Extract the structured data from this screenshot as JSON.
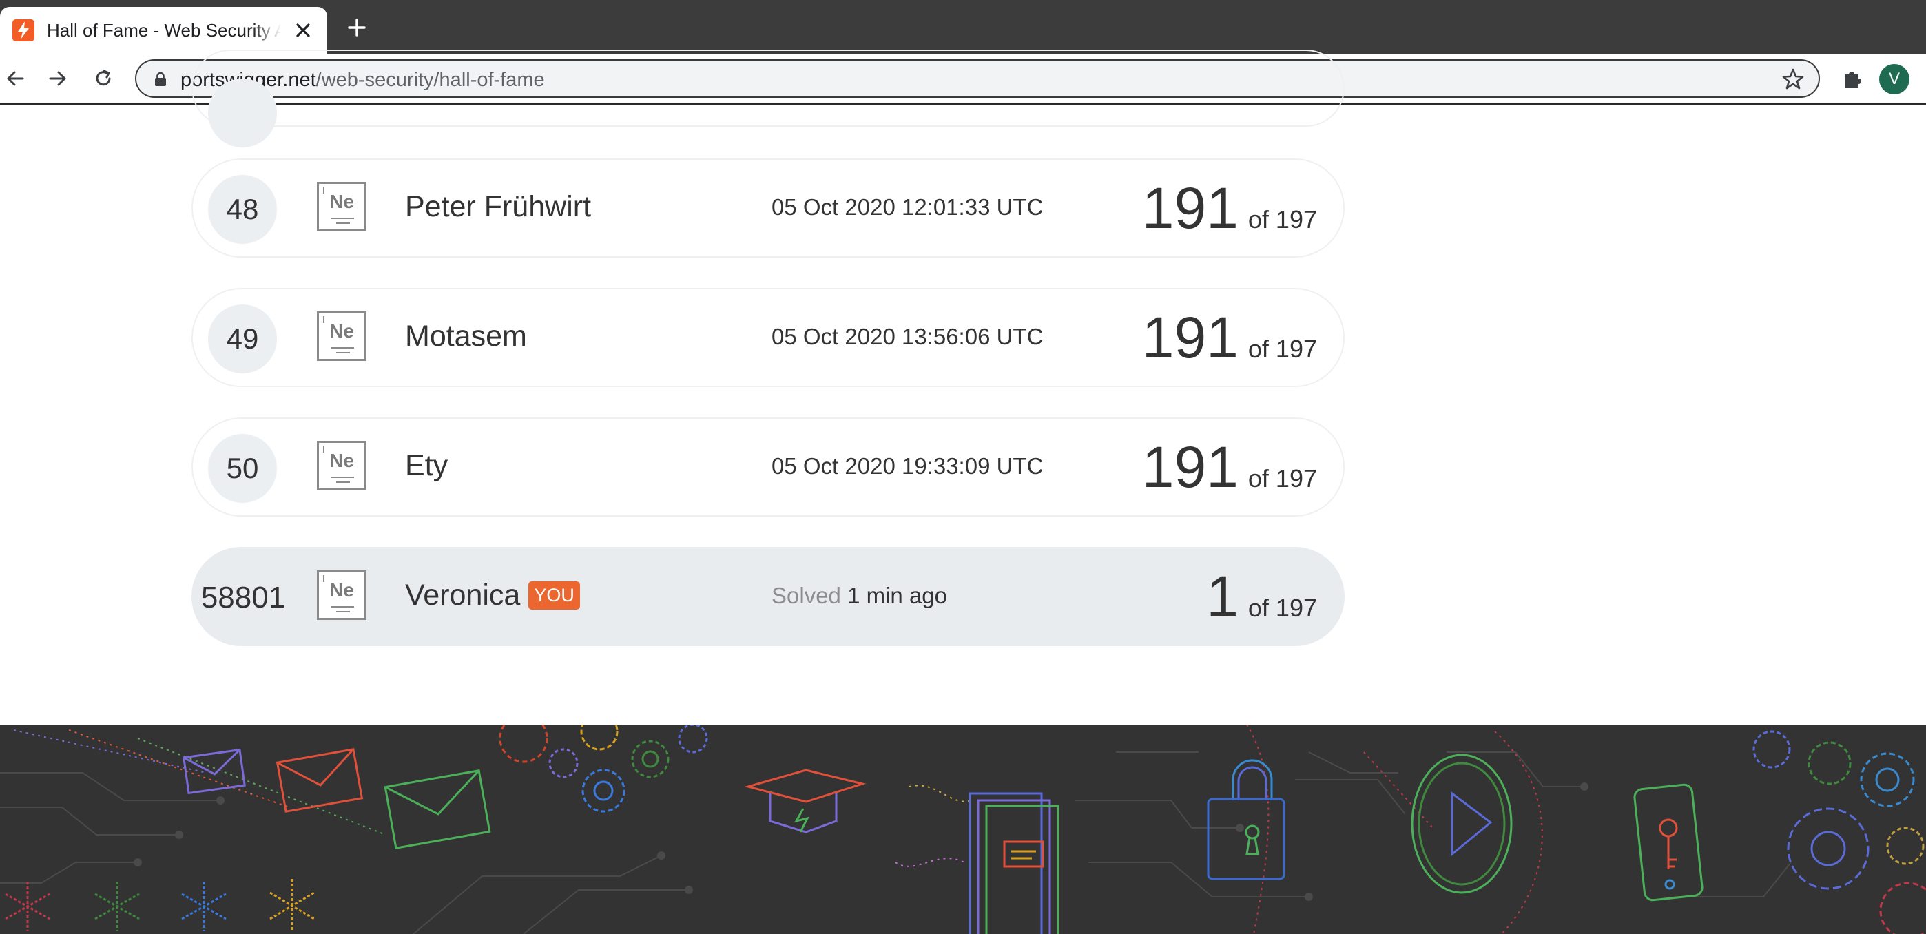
{
  "browser": {
    "tab_title": "Hall of Fame - Web Security Academy",
    "url_host": "portswigger.net",
    "url_path": "/web-security/hall-of-fame",
    "profile_initial": "V"
  },
  "colors": {
    "accent": "#ec6730",
    "favicon": "#f25c27",
    "footer_bg": "#333333",
    "current_user_row": "#e9ecef"
  },
  "leaderboard": {
    "rows": [
      {
        "rank": "48",
        "element": "Ne",
        "name": "Peter Frühwirt",
        "date": "05 Oct 2020 12:01:33 UTC",
        "score": "191",
        "total": "of 197"
      },
      {
        "rank": "49",
        "element": "Ne",
        "name": "Motasem",
        "date": "05 Oct 2020 13:56:06 UTC",
        "score": "191",
        "total": "of 197"
      },
      {
        "rank": "50",
        "element": "Ne",
        "name": "Ety",
        "date": "05 Oct 2020 19:33:09 UTC",
        "score": "191",
        "total": "of 197"
      }
    ],
    "current_user": {
      "rank": "58801",
      "element": "Ne",
      "name": "Veronica",
      "badge": "YOU",
      "solved_label": "Solved",
      "solved_time": "1 min ago",
      "score": "1",
      "total": "of 197"
    }
  }
}
